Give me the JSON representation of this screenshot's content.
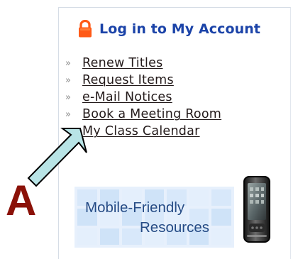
{
  "account": {
    "heading": "Log in to My Account",
    "icon": "lock-icon",
    "icon_color": "#ff5a17",
    "heading_color": "#1b43a8"
  },
  "links": [
    {
      "label": "Renew Titles",
      "bullet": "»"
    },
    {
      "label": "Request Items",
      "bullet": "»"
    },
    {
      "label": "e-Mail Notices",
      "bullet": "»"
    },
    {
      "label": "Book a Meeting Room",
      "bullet": "»"
    },
    {
      "label": "My Class Calendar",
      "bullet": ""
    }
  ],
  "mobile": {
    "line1": "Mobile-Friendly",
    "line2": "Resources",
    "icon": "smartphone-icon",
    "text_color": "#254b85"
  },
  "annotation": {
    "letter": "A",
    "arrow_color": "#b8e4e6",
    "letter_color": "#8b1108"
  }
}
